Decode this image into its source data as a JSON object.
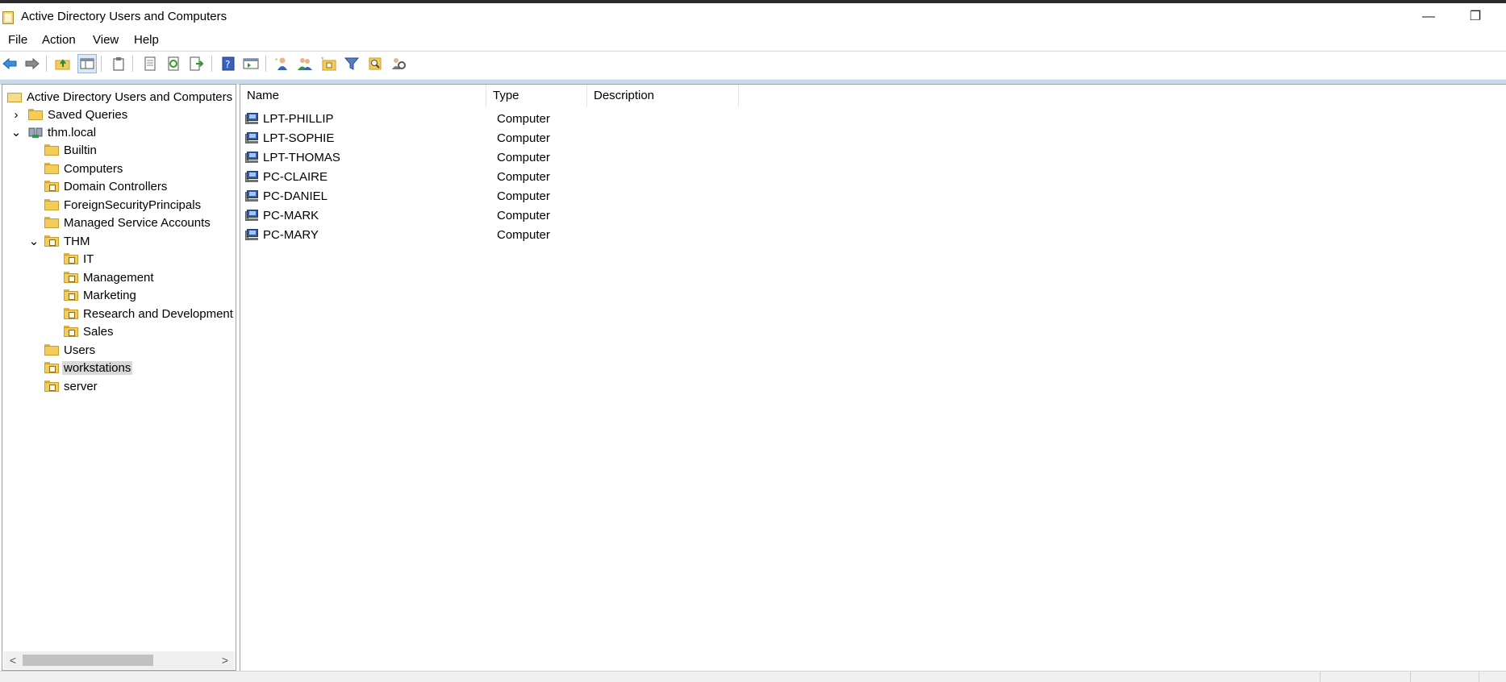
{
  "window": {
    "title": "Active Directory Users and Computers",
    "controls": {
      "minimize": "—",
      "restore": "❐"
    }
  },
  "menu": [
    "File",
    "Action",
    "View",
    "Help"
  ],
  "toolbar": {
    "icons": [
      "back-icon",
      "forward-icon",
      "up-folder-icon",
      "show-hide-tree-icon",
      "clipboard-icon",
      "properties-icon",
      "refresh-icon",
      "export-list-icon",
      "help-icon",
      "console-pane-icon",
      "new-user-icon",
      "new-group-icon",
      "new-ou-icon",
      "filter-icon",
      "find-icon",
      "delegate-icon"
    ]
  },
  "tree": {
    "root": "Active Directory Users and Computers [",
    "nodes": [
      {
        "label": "Saved Queries",
        "level": 1,
        "expander": "›",
        "kind": "folder"
      },
      {
        "label": "thm.local",
        "level": 1,
        "expander": "⌄",
        "kind": "domain"
      },
      {
        "label": "Builtin",
        "level": 2,
        "kind": "folder"
      },
      {
        "label": "Computers",
        "level": 2,
        "kind": "folder"
      },
      {
        "label": "Domain Controllers",
        "level": 2,
        "kind": "ou"
      },
      {
        "label": "ForeignSecurityPrincipals",
        "level": 2,
        "kind": "folder"
      },
      {
        "label": "Managed Service Accounts",
        "level": 2,
        "kind": "folder"
      },
      {
        "label": "THM",
        "level": 2,
        "expander": "⌄",
        "kind": "ou"
      },
      {
        "label": "IT",
        "level": 3,
        "kind": "ou"
      },
      {
        "label": "Management",
        "level": 3,
        "kind": "ou"
      },
      {
        "label": "Marketing",
        "level": 3,
        "kind": "ou"
      },
      {
        "label": "Research and Development",
        "level": 3,
        "kind": "ou"
      },
      {
        "label": "Sales",
        "level": 3,
        "kind": "ou"
      },
      {
        "label": "Users",
        "level": 2,
        "kind": "folder"
      },
      {
        "label": "workstations",
        "level": 2,
        "kind": "ou",
        "selected": true
      },
      {
        "label": "server",
        "level": 2,
        "kind": "ou"
      }
    ],
    "scroll": {
      "left": "<",
      "right": ">"
    }
  },
  "list": {
    "columns": [
      "Name",
      "Type",
      "Description"
    ],
    "rows": [
      {
        "name": "LPT-PHILLIP",
        "type": "Computer",
        "description": ""
      },
      {
        "name": "LPT-SOPHIE",
        "type": "Computer",
        "description": ""
      },
      {
        "name": "LPT-THOMAS",
        "type": "Computer",
        "description": ""
      },
      {
        "name": "PC-CLAIRE",
        "type": "Computer",
        "description": ""
      },
      {
        "name": "PC-DANIEL",
        "type": "Computer",
        "description": ""
      },
      {
        "name": "PC-MARK",
        "type": "Computer",
        "description": ""
      },
      {
        "name": "PC-MARY",
        "type": "Computer",
        "description": ""
      }
    ]
  },
  "colors": {
    "accent": "#c9d9ea",
    "selection": "#d9d9d9",
    "folder": "#f3cc5a"
  }
}
